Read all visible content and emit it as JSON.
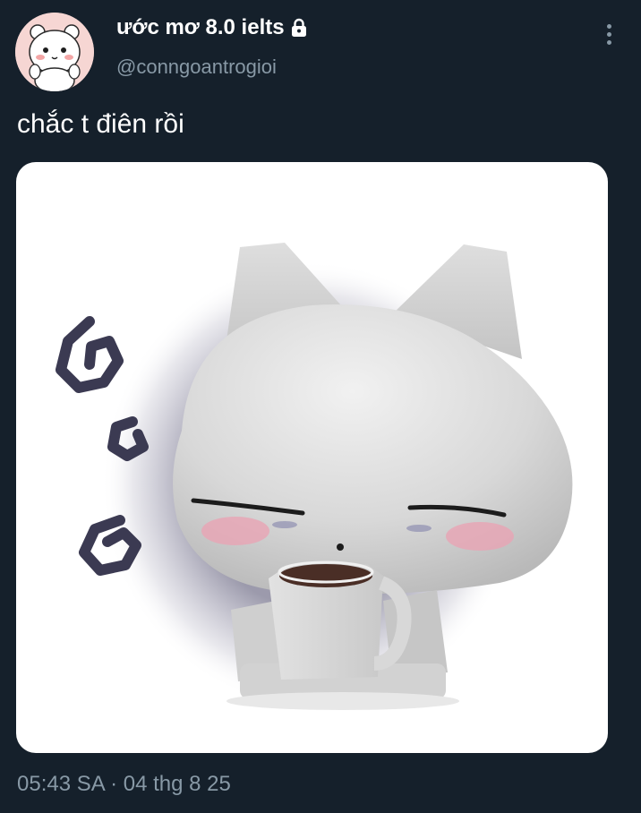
{
  "tweet": {
    "display_name": "ước mơ 8.0 ielts",
    "handle": "@conngoantrogioi",
    "text": "chắc t điên rồi",
    "time": "05:43 SA",
    "separator": "·",
    "date": "04 thg 8 25"
  },
  "icons": {
    "avatar": "avatar-chiikawa-icon",
    "locked": "lock-icon",
    "more": "more-vertical-icon"
  },
  "colors": {
    "background": "#15202b",
    "primary_text": "#ffffff",
    "secondary_text": "#8899a6",
    "avatar_background": "#f6d6d3",
    "media_background": "#ffffff"
  }
}
